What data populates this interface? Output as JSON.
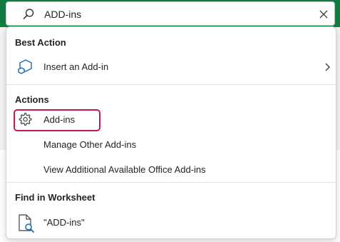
{
  "search": {
    "value": "ADD-ins",
    "icons": {
      "search": "search-icon",
      "clear": "close-icon"
    }
  },
  "best_action": {
    "title": "Best Action",
    "items": [
      {
        "label": "Insert an Add-in",
        "icon": "add-in-cube-icon",
        "has_submenu": true
      }
    ]
  },
  "actions": {
    "title": "Actions",
    "items": [
      {
        "label": "Add-ins",
        "icon": "gear-icon",
        "highlighted": true
      },
      {
        "label": "Manage Other Add-ins"
      },
      {
        "label": "View Additional Available Office Add-ins"
      }
    ]
  },
  "find_in_worksheet": {
    "title": "Find in Worksheet",
    "items": [
      {
        "label": "\"ADD-ins\"",
        "icon": "document-search-icon"
      }
    ]
  },
  "colors": {
    "highlight_border": "#c2185b",
    "icon_blue": "#0f6cbd",
    "title_bar": "#107c41"
  }
}
